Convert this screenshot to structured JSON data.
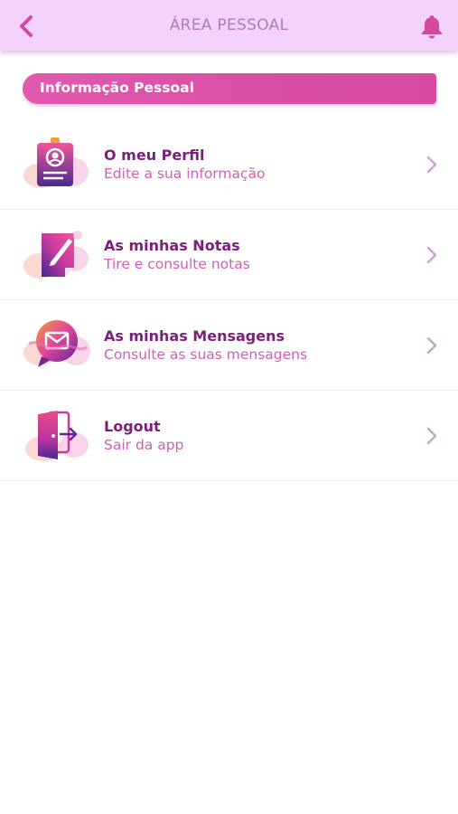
{
  "header": {
    "title": "ÁREA PESSOAL"
  },
  "section": {
    "title": "Informação Pessoal"
  },
  "menu": {
    "items": [
      {
        "title": "O meu Perfil",
        "subtitle": "Edite a sua informação",
        "icon": "profile-badge-icon"
      },
      {
        "title": "As minhas Notas",
        "subtitle": "Tire e consulte notas",
        "icon": "notes-pen-icon"
      },
      {
        "title": "As minhas Mensagens",
        "subtitle": "Consulte as suas mensagens",
        "icon": "message-bubble-icon"
      },
      {
        "title": "Logout",
        "subtitle": "Sair da app",
        "icon": "logout-door-icon"
      }
    ]
  },
  "colors": {
    "topbar_bg": "#f3d3fb",
    "accent_pink": "#d94fa5",
    "title_purple": "#7b1f7b",
    "subtitle_pink": "#cf5fb6"
  }
}
